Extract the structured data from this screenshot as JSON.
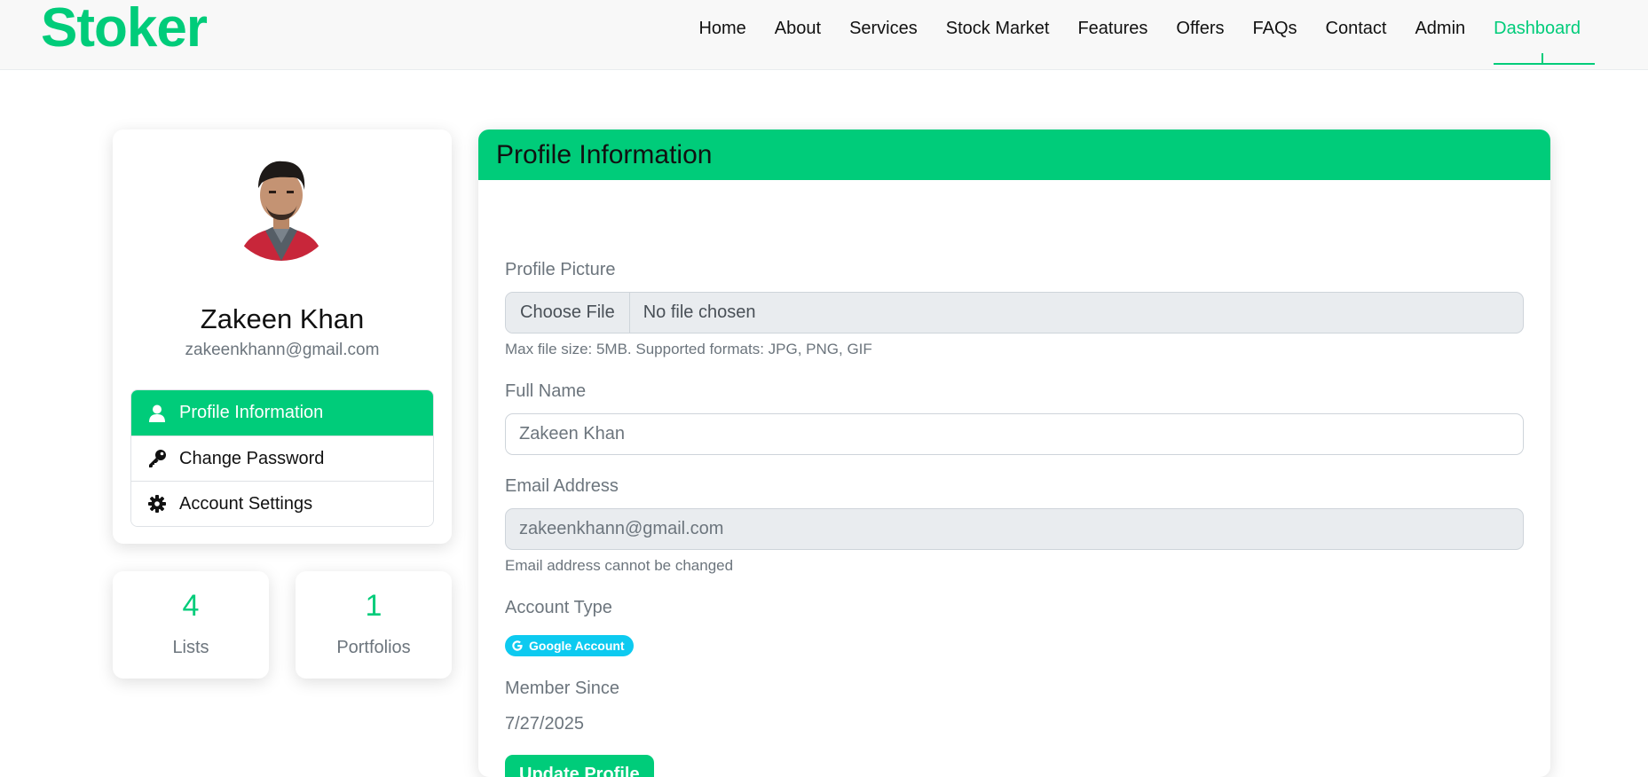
{
  "brand": "Stoker",
  "nav": {
    "home": "Home",
    "about": "About",
    "services": "Services",
    "stock_market": "Stock Market",
    "features": "Features",
    "offers": "Offers",
    "faqs": "FAQs",
    "contact": "Contact",
    "admin": "Admin",
    "dashboard": "Dashboard"
  },
  "colors": {
    "accent": "#00cc7a",
    "badge": "#0dcaf0"
  },
  "sidebar": {
    "avatar_icon": "user-photo",
    "name": "Zakeen Khan",
    "email": "zakeenkhann@gmail.com",
    "menu": [
      {
        "label": "Profile Information",
        "icon": "user-icon",
        "active": true
      },
      {
        "label": "Change Password",
        "icon": "key-icon",
        "active": false
      },
      {
        "label": "Account Settings",
        "icon": "gear-icon",
        "active": false
      }
    ]
  },
  "stats": [
    {
      "value": "4",
      "label": "Lists"
    },
    {
      "value": "1",
      "label": "Portfolios"
    }
  ],
  "profile": {
    "title": "Profile Information",
    "picture_label": "Profile Picture",
    "choose_file": "Choose File",
    "no_file": "No file chosen",
    "file_help": "Max file size: 5MB. Supported formats: JPG, PNG, GIF",
    "full_name_label": "Full Name",
    "full_name_value": "Zakeen Khan",
    "email_label": "Email Address",
    "email_value": "zakeenkhann@gmail.com",
    "email_help": "Email address cannot be changed",
    "account_type_label": "Account Type",
    "account_type_badge": "Google Account",
    "member_since_label": "Member Since",
    "member_since_value": "7/27/2025",
    "update_button": "Update Profile"
  }
}
